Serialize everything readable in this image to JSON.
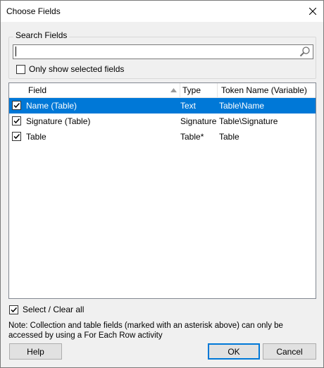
{
  "window": {
    "title": "Choose Fields"
  },
  "search": {
    "group_label": "Search Fields",
    "value": "",
    "placeholder": ""
  },
  "only_show_selected": {
    "label": "Only show selected fields",
    "checked": false
  },
  "columns": [
    "Field",
    "Type",
    "Token Name (Variable)"
  ],
  "rows": [
    {
      "field": "Name (Table)",
      "type": "Text",
      "token": "Table\\Name",
      "checked": true,
      "selected": true
    },
    {
      "field": "Signature (Table)",
      "type": "Signature",
      "token": "Table\\Signature",
      "checked": true,
      "selected": false
    },
    {
      "field": "Table",
      "type": "Table*",
      "token": "Table",
      "checked": true,
      "selected": false
    }
  ],
  "select_all": {
    "label": "Select / Clear all",
    "checked": true
  },
  "note": "Note: Collection and table fields (marked with an asterisk above) can only be accessed by using a For Each Row activity",
  "buttons": {
    "help": "Help",
    "ok": "OK",
    "cancel": "Cancel"
  },
  "colors": {
    "selection": "#0078d7",
    "dialog_bg": "#f0f0f0"
  },
  "icons": {
    "close": "close-icon",
    "search": "search-icon",
    "sort": "sort-ascending-icon"
  }
}
